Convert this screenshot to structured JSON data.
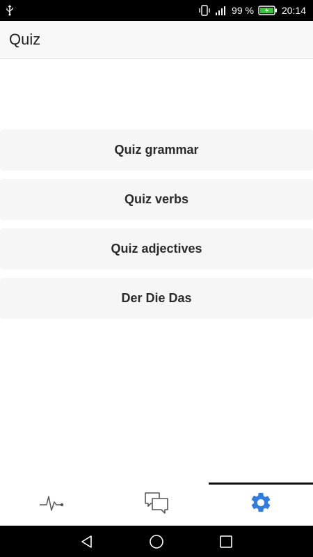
{
  "status_bar": {
    "battery_percent": "99 %",
    "time": "20:14",
    "icons": [
      "usb-icon",
      "vibrate-icon",
      "signal-icon",
      "battery-charging-icon"
    ]
  },
  "app_bar": {
    "title": "Quiz"
  },
  "quiz_buttons": [
    {
      "label": "Quiz grammar"
    },
    {
      "label": "Quiz verbs"
    },
    {
      "label": "Quiz adjectives"
    },
    {
      "label": "Der Die Das"
    }
  ],
  "tab_bar": {
    "tabs": [
      {
        "icon": "activity-icon",
        "active": false
      },
      {
        "icon": "chat-icon",
        "active": false
      },
      {
        "icon": "gear-icon",
        "active": true
      }
    ],
    "active_color": "#2f7de1"
  },
  "nav_bar": {
    "icons": [
      "back-icon",
      "home-icon",
      "recents-icon"
    ]
  }
}
